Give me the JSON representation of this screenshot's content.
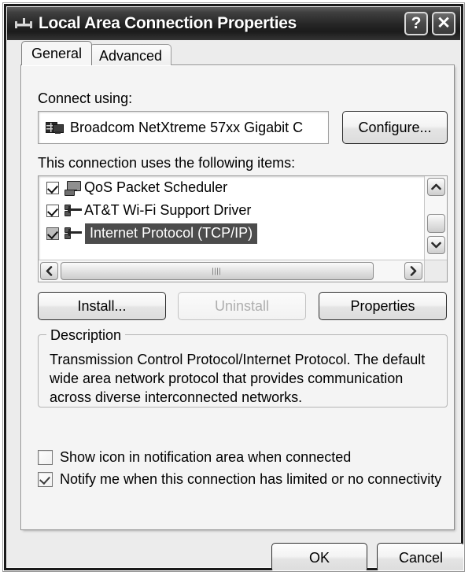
{
  "window": {
    "title": "Local Area Connection Properties",
    "icon": "network-connection-icon",
    "help_label": "?",
    "close_label": "✕"
  },
  "tabs": [
    {
      "label": "General",
      "active": true
    },
    {
      "label": "Advanced",
      "active": false
    }
  ],
  "general": {
    "connect_using_label": "Connect using:",
    "adapter": {
      "name": "Broadcom NetXtreme 57xx Gigabit C",
      "icon": "network-adapter-icon"
    },
    "configure_button": "Configure...",
    "items_label": "This connection uses the following items:",
    "items": [
      {
        "label": "QoS Packet Scheduler",
        "checked": true,
        "selected": false,
        "icon": "computer-icon"
      },
      {
        "label": "AT&T Wi-Fi Support Driver",
        "checked": true,
        "selected": false,
        "icon": "protocol-icon"
      },
      {
        "label": "Internet Protocol (TCP/IP)",
        "checked": true,
        "selected": true,
        "icon": "protocol-icon"
      }
    ],
    "install_button": "Install...",
    "uninstall_button": "Uninstall",
    "uninstall_enabled": false,
    "properties_button": "Properties",
    "description_title": "Description",
    "description_text": "Transmission Control Protocol/Internet Protocol. The default wide area network protocol that provides communication across diverse interconnected networks.",
    "checkbox_show_icon": {
      "label": "Show icon in notification area when connected",
      "checked": false
    },
    "checkbox_notify": {
      "label": "Notify me when this connection has limited or no connectivity",
      "checked": true
    }
  },
  "footer": {
    "ok_label": "OK",
    "cancel_label": "Cancel"
  },
  "scrollbars": {
    "vertical": {
      "up": "▲",
      "down": "▼"
    },
    "horizontal": {
      "left": "◀",
      "right": "▶"
    }
  },
  "colors": {
    "titlebar": "#262626",
    "selection": "#4c4c4c",
    "dialog_bg": "#ececec",
    "page_bg": "#f4f4f4"
  }
}
